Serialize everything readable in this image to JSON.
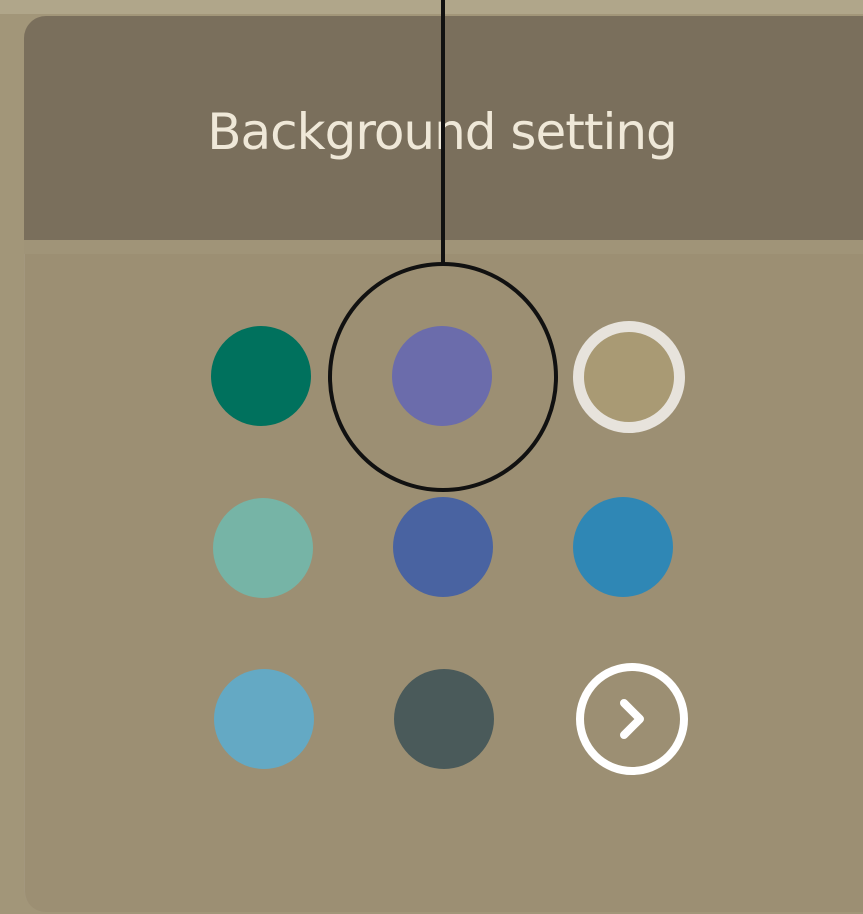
{
  "settings_panel": {
    "title": "Background setting"
  },
  "swatches": [
    {
      "id": "swatch-dark-teal",
      "color": "#00715d",
      "selected": false
    },
    {
      "id": "swatch-periwinkle",
      "color": "#6b6cab",
      "selected": false
    },
    {
      "id": "swatch-beige",
      "color": "#a99a74",
      "selected": true
    },
    {
      "id": "swatch-sage",
      "color": "#76b4a6",
      "selected": false
    },
    {
      "id": "swatch-indigo",
      "color": "#4963a1",
      "selected": false
    },
    {
      "id": "swatch-ocean-blue",
      "color": "#2f87b5",
      "selected": false
    },
    {
      "id": "swatch-sky-blue",
      "color": "#64a9c4",
      "selected": false
    },
    {
      "id": "swatch-slate",
      "color": "#4a5a5a",
      "selected": false
    }
  ],
  "next_button": {
    "icon": "chevron-right-icon",
    "color": "#ffffff"
  },
  "callout": {
    "color": "#111111"
  }
}
